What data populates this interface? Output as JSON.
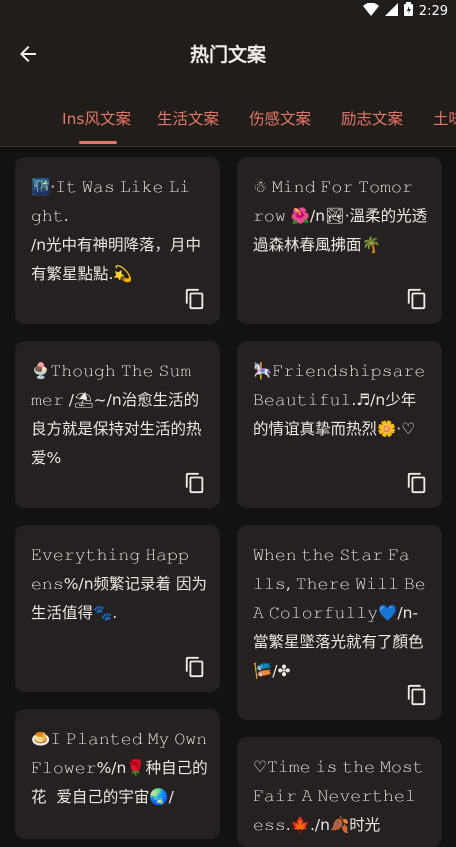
{
  "status": {
    "time": "2:29"
  },
  "appbar": {
    "title": "热门文案"
  },
  "tabs": [
    "Ins风文案",
    "生活文案",
    "伤感文案",
    "励志文案",
    "土味"
  ],
  "cards": [
    {
      "text": "🌃·𝙸𝚝 𝚆𝚊𝚜 𝙻𝚒𝚔𝚎 𝙻𝚒𝚐𝚑𝚝.\n/n光中有神明降落，月中有繁星點點.💫"
    },
    {
      "text": "☃ 𝙼𝚒𝚗𝚍 𝙵𝚘𝚛 𝚃𝚘𝚖𝚘𝚛𝚛𝚘𝚠 🌺/n🏞·溫柔的光透過森林春風拂面🌴"
    },
    {
      "text": "🍨𝚃𝚑𝚘𝚞𝚐𝚑 𝚃𝚑𝚎 𝚂𝚞𝚖𝚖𝚎𝚛 /⛱~/n治愈生活的良方就是保持对生活的热爱%"
    },
    {
      "text": "🎠𝙵𝚛𝚒𝚎𝚗𝚍𝚜𝚑𝚒𝚙𝚜𝚊𝚛𝚎\n𝙱𝚎𝚊𝚞𝚝𝚒𝚏𝚞𝚕.♬/n少年的情谊真挚而热烈🌼·♡"
    },
    {
      "text": "𝙴𝚟𝚎𝚛𝚢𝚝𝚑𝚒𝚗𝚐 𝙷𝚊𝚙𝚙𝚎𝚗𝚜%/n频繁记录着 因为生活值得🐾."
    },
    {
      "text": "𝚆𝚑𝚎𝚗 𝚝𝚑𝚎 𝚂𝚝𝚊𝚛 𝙵𝚊𝚕𝚕𝚜, 𝚃𝚑𝚎𝚛𝚎 𝚆𝚒𝚕𝚕 𝙱𝚎 𝙰 𝙲𝚘𝚕𝚘𝚛𝚏𝚞𝚕𝚕𝚢💙/n-當繁星墜落光就有了顏色🎏/✤"
    },
    {
      "text": "🍮𝙸 𝙿𝚕𝚊𝚗𝚝𝚎𝚍 𝙼𝚢 𝙾𝚠𝚗 𝙵𝚕𝚘𝚠𝚎𝚛%/n🌹种自己的花  爱自己的宇宙🌏/"
    },
    {
      "text": "♡𝚃𝚒𝚖𝚎 𝚒𝚜 𝚝𝚑𝚎 𝙼𝚘𝚜𝚝 𝙵𝚊𝚒𝚛 𝙰 𝙽𝚎𝚟𝚎𝚛𝚝𝚑𝚎𝚕𝚎𝚜𝚜.🍁./n🍂时光"
    }
  ]
}
